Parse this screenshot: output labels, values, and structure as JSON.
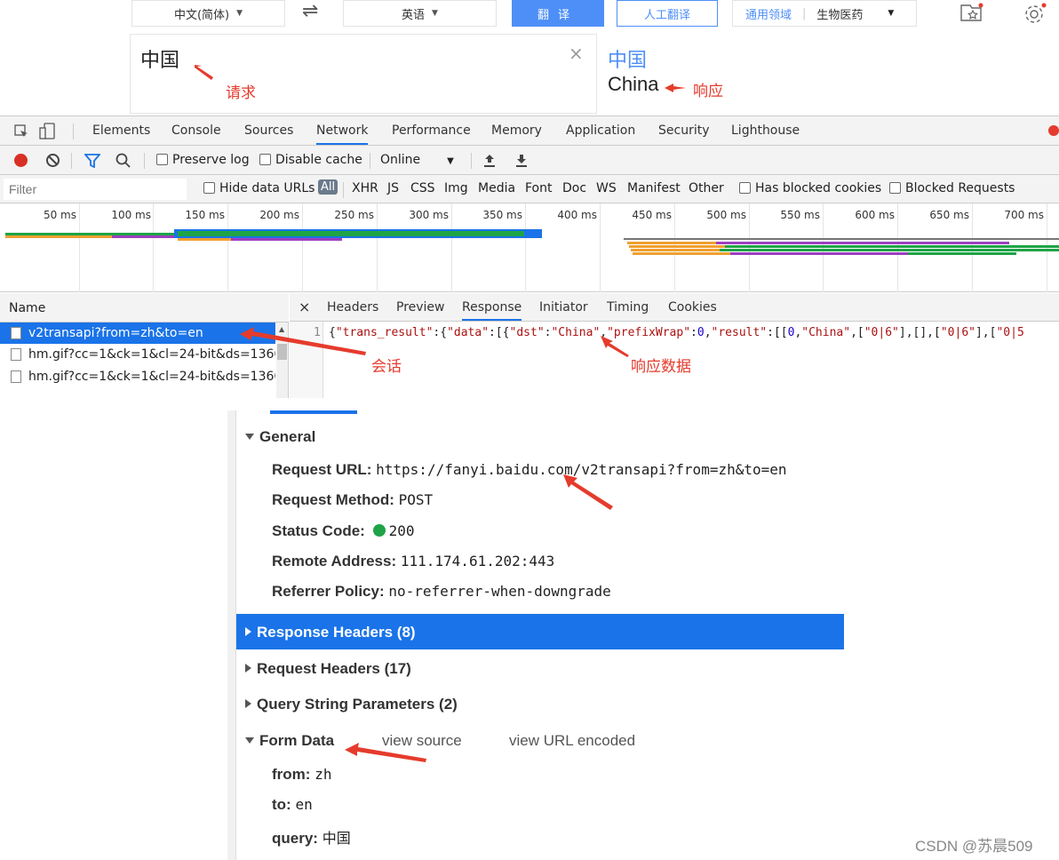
{
  "translator": {
    "source_lang": "中文(简体)",
    "swap_icon": "⇌",
    "target_lang": "英语",
    "translate_btn": "翻译",
    "human_btn": "人工翻译",
    "domain_label": "通用领域",
    "domain_value": "生物医药",
    "input_text": "中国",
    "clear_icon": "×",
    "output_source": "中国",
    "output_text": "China",
    "annotation_request": "请求",
    "annotation_response": "响应"
  },
  "devtools": {
    "tabs": [
      "Elements",
      "Console",
      "Sources",
      "Network",
      "Performance",
      "Memory",
      "Application",
      "Security",
      "Lighthouse"
    ],
    "active_tab": "Network",
    "toolbar": {
      "preserve_log": "Preserve log",
      "disable_cache": "Disable cache",
      "throttle": "Online"
    },
    "filter": {
      "placeholder": "Filter",
      "hide_data_urls": "Hide data URLs",
      "types": [
        "All",
        "XHR",
        "JS",
        "CSS",
        "Img",
        "Media",
        "Font",
        "Doc",
        "WS",
        "Manifest",
        "Other"
      ],
      "blocked_cookies": "Has blocked cookies",
      "blocked_requests": "Blocked Requests"
    },
    "ticks": [
      "50 ms",
      "100 ms",
      "150 ms",
      "200 ms",
      "250 ms",
      "300 ms",
      "350 ms",
      "400 ms",
      "450 ms",
      "500 ms",
      "550 ms",
      "600 ms",
      "650 ms",
      "700 ms"
    ],
    "name_header": "Name",
    "requests": [
      "v2transapi?from=zh&to=en",
      "hm.gif?cc=1&ck=1&cl=24-bit&ds=1366x",
      "hm.gif?cc=1&ck=1&cl=24-bit&ds=1366x"
    ],
    "detail_tabs": [
      "Headers",
      "Preview",
      "Response",
      "Initiator",
      "Timing",
      "Cookies"
    ],
    "active_detail_tab": "Response",
    "close_icon": "×",
    "response_line_no": "1",
    "response": {
      "p1": "{",
      "k1": "\"trans_result\"",
      "p2": ":{",
      "k2": "\"data\"",
      "p3": ":[{",
      "k3": "\"dst\"",
      "p4": ":",
      "v3": "\"China\"",
      "p5": ",",
      "k4": "\"prefixWrap\"",
      "p6": ":",
      "n1": "0",
      "p7": ",",
      "k5": "\"result\"",
      "p8": ":[[",
      "n2": "0",
      "p9": ",",
      "v4": "\"China\"",
      "p10": ",[",
      "v5": "\"0|6\"",
      "p11": "],[],[",
      "v6": "\"0|6\"",
      "p12": "],[",
      "v7": "\"0|5"
    },
    "annotation_session": "会话",
    "annotation_response_data": "响应数据"
  },
  "headers_panel": {
    "general_title": "General",
    "request_url_label": "Request URL:",
    "request_url": "https://fanyi.baidu.com/v2transapi?from=zh&to=en",
    "method_label": "Request Method:",
    "method": "POST",
    "status_label": "Status Code:",
    "status": "200",
    "remote_label": "Remote Address:",
    "remote": "111.174.61.202:443",
    "referrer_label": "Referrer Policy:",
    "referrer": "no-referrer-when-downgrade",
    "response_headers": "Response Headers (8)",
    "request_headers": "Request Headers (17)",
    "query_params": "Query String Parameters (2)",
    "form_data": "Form Data",
    "view_source": "view source",
    "view_url_encoded": "view URL encoded",
    "form_fields": [
      {
        "key": "from:",
        "value": "zh"
      },
      {
        "key": "to:",
        "value": "en"
      },
      {
        "key": "query:",
        "value": "中国"
      }
    ]
  },
  "watermark": "CSDN @苏晨509",
  "colors": {
    "accent": "#1a73e8",
    "annotation": "#e53b2c",
    "selected_row": "#1a73e8"
  }
}
